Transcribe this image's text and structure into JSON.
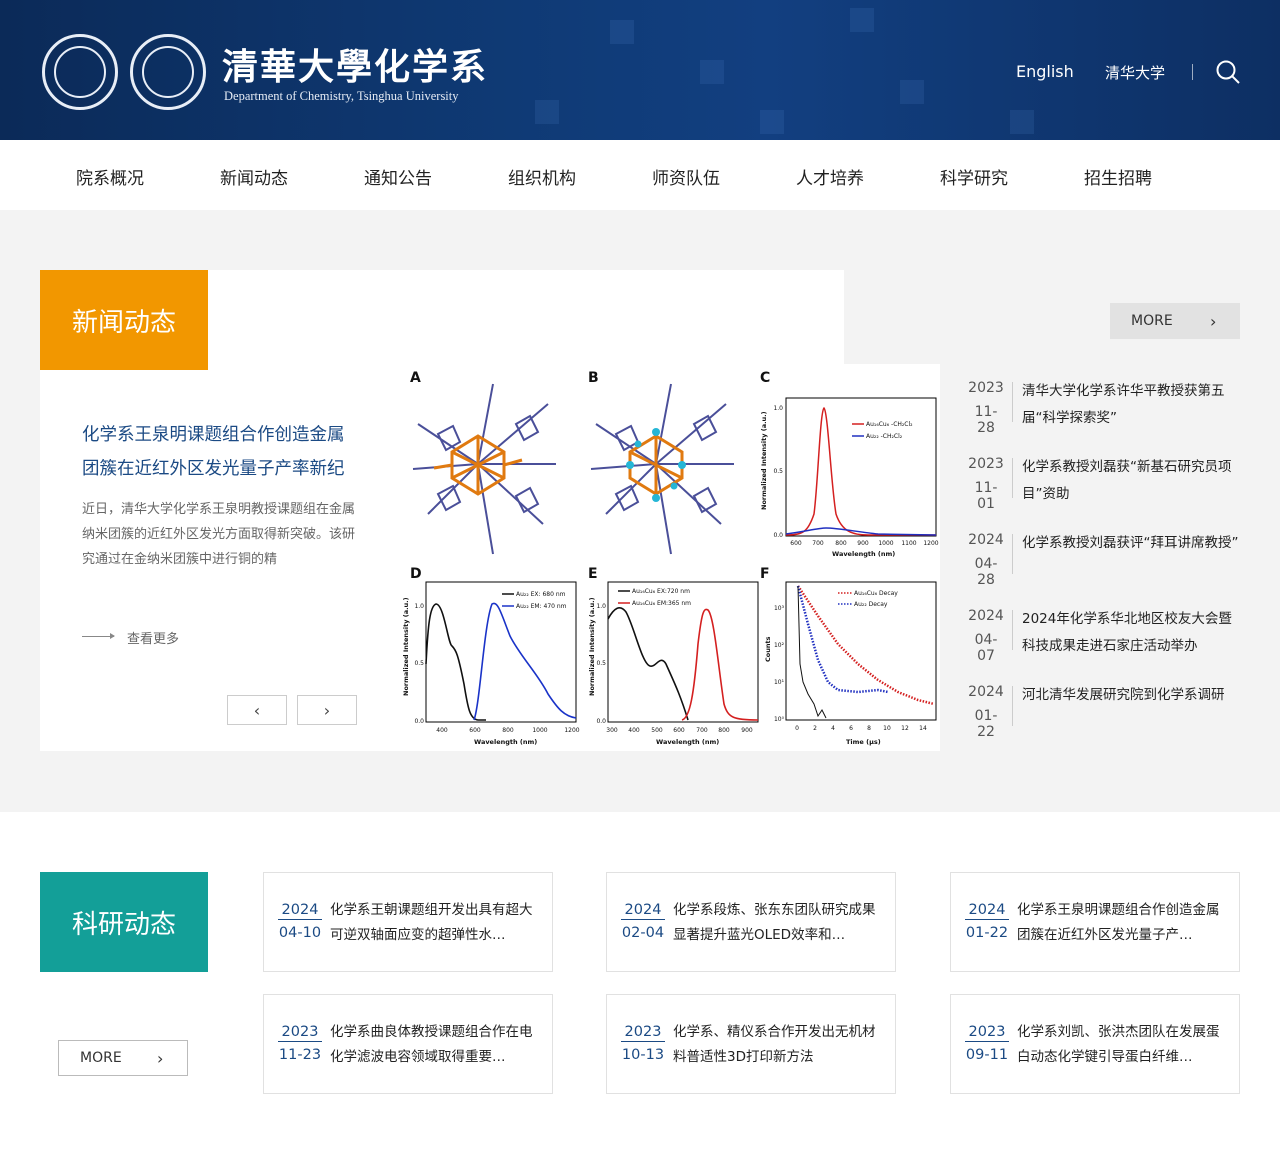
{
  "header": {
    "title": "清華大學化学系",
    "subtitle": "Department of Chemistry, Tsinghua University",
    "link_english": "English",
    "link_tsinghua": "清华大学"
  },
  "nav": [
    "院系概况",
    "新闻动态",
    "通知公告",
    "组织机构",
    "师资队伍",
    "人才培养",
    "科学研究",
    "招生招聘"
  ],
  "news": {
    "section_title": "新闻动态",
    "more_label": "MORE",
    "featured": {
      "title": "化学系王泉明课题组合作创造金属团簇在近红外区发光量子产率新纪",
      "desc": "近日，清华大学化学系王泉明教授课题组在金属纳米团簇的近红外区发光方面取得新突破。该研究通过在金纳米团簇中进行铜的精",
      "read_more": "查看更多"
    },
    "figure": {
      "panels": [
        "A",
        "B",
        "C",
        "D",
        "E",
        "F"
      ],
      "c_legend": [
        "Au₁₆Cu₆ -CH₂Cl₂",
        "Au₂₂ -CH₂Cl₂"
      ],
      "c_xlabel": "Wavelength (nm)",
      "c_ylabel": "Normalized Intensity (a.u.)",
      "c_xticks": [
        "600",
        "700",
        "800",
        "900",
        "1000",
        "1100",
        "1200"
      ],
      "c_yticks": [
        "0.0",
        "0.5",
        "1.0"
      ],
      "d_legend": [
        "Au₂₂ EX: 680 nm",
        "Au₂₂ EM: 470 nm"
      ],
      "d_xlabel": "Wavelength (nm)",
      "d_ylabel": "Normalized Intensity (a.u.)",
      "d_xticks": [
        "400",
        "600",
        "800",
        "1000",
        "1200"
      ],
      "d_yticks": [
        "0.0",
        "0.5",
        "1.0"
      ],
      "e_legend": [
        "Au₁₆Cu₆ EX:720 nm",
        "Au₁₆Cu₆ EM:365 nm"
      ],
      "e_xlabel": "Wavelength (nm)",
      "e_ylabel": "Normalized Intensity (a.u.)",
      "e_xticks": [
        "300",
        "400",
        "500",
        "600",
        "700",
        "800",
        "900"
      ],
      "e_yticks": [
        "0.0",
        "0.5",
        "1.0"
      ],
      "f_legend": [
        "Au₁₆Cu₆ Decay",
        "Au₂₂ Decay"
      ],
      "f_xlabel": "Time (μs)",
      "f_ylabel": "Counts",
      "f_xticks": [
        "0",
        "2",
        "4",
        "6",
        "8",
        "10",
        "12",
        "14"
      ],
      "f_yticks": [
        "10⁰",
        "10¹",
        "10²",
        "10³"
      ]
    },
    "list": [
      {
        "year": "2023",
        "date": "11-28",
        "title": "清华大学化学系许华平教授获第五届“科学探索奖”"
      },
      {
        "year": "2023",
        "date": "11-01",
        "title": "化学系教授刘磊获“新基石研究员项目”资助"
      },
      {
        "year": "2024",
        "date": "04-28",
        "title": "化学系教授刘磊获评“拜耳讲席教授”"
      },
      {
        "year": "2024",
        "date": "04-07",
        "title": "2024年化学系华北地区校友大会暨科技成果走进石家庄活动举办"
      },
      {
        "year": "2024",
        "date": "01-22",
        "title": "河北清华发展研究院到化学系调研"
      }
    ]
  },
  "research": {
    "section_title": "科研动态",
    "more_label": "MORE",
    "items": [
      {
        "year": "2024",
        "date": "04-10",
        "title": "化学系王朝课题组开发出具有超大可逆双轴面应变的超弹性水…"
      },
      {
        "year": "2024",
        "date": "02-04",
        "title": "化学系段炼、张东东团队研究成果显著提升蓝光OLED效率和…"
      },
      {
        "year": "2024",
        "date": "01-22",
        "title": "化学系王泉明课题组合作创造金属团簇在近红外区发光量子产…"
      },
      {
        "year": "2023",
        "date": "11-23",
        "title": "化学系曲良体教授课题组合作在电化学滤波电容领域取得重要…"
      },
      {
        "year": "2023",
        "date": "10-13",
        "title": "化学系、精仪系合作开发出无机材料普适性3D打印新方法"
      },
      {
        "year": "2023",
        "date": "09-11",
        "title": "化学系刘凯、张洪杰团队在发展蛋白动态化学键引导蛋白纤维…"
      }
    ]
  },
  "colors": {
    "header_bg": "#0f3a75",
    "news_accent": "#f29700",
    "research_accent": "#139f98",
    "link_blue": "#1b4a84"
  }
}
